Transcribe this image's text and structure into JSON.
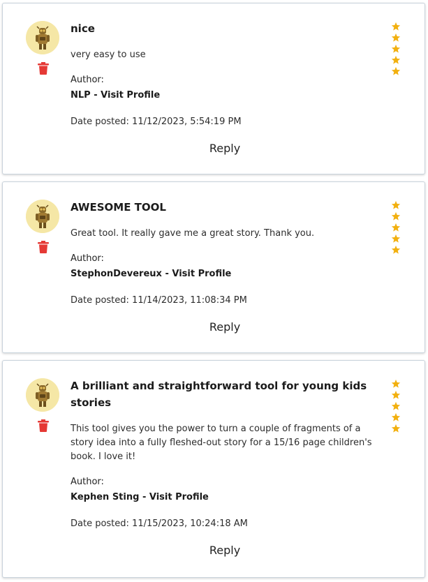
{
  "colors": {
    "star": "#F2B00F",
    "trash": "#E53935",
    "avatar_bg": "#F5E7A6"
  },
  "reviews": [
    {
      "title": "nice",
      "body": "very easy to use",
      "author_label": "Author:",
      "author_name": "NLP",
      "author_sep": " - ",
      "profile_link": "Visit Profile",
      "date": "Date posted: 11/12/2023, 5:54:19 PM",
      "reply": "Reply",
      "rating": 5
    },
    {
      "title": "AWESOME TOOL",
      "body": "Great tool. It really gave me a great story. Thank you.",
      "author_label": "Author:",
      "author_name": "StephonDevereux",
      "author_sep": " - ",
      "profile_link": "Visit Profile",
      "date": "Date posted: 11/14/2023, 11:08:34 PM",
      "reply": "Reply",
      "rating": 5
    },
    {
      "title": "A brilliant and straightforward tool for young kids stories",
      "body": "This tool gives you the power to turn a couple of fragments of a story idea into a fully fleshed-out story for a 15/16 page children's book. I love it!",
      "author_label": "Author:",
      "author_name": "Kephen Sting",
      "author_sep": " - ",
      "profile_link": "Visit Profile",
      "date": "Date posted: 11/15/2023, 10:24:18 AM",
      "reply": "Reply",
      "rating": 5
    }
  ]
}
